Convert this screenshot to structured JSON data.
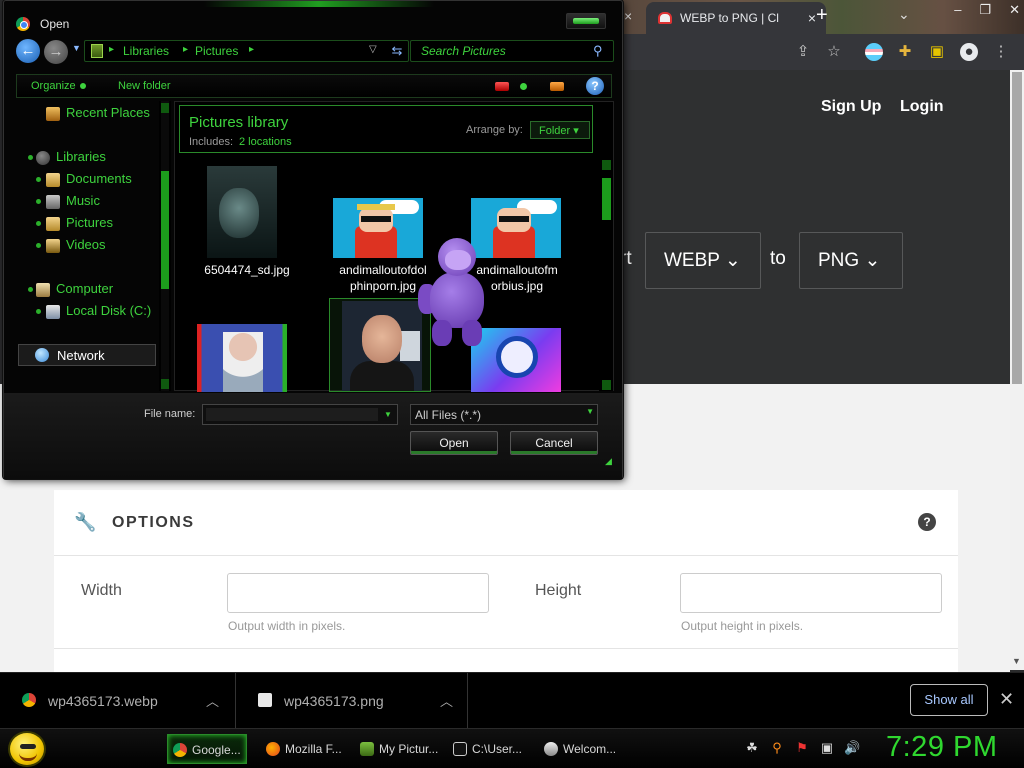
{
  "browser": {
    "tab_title": "WEBP to PNG | Cl",
    "new_tab": "+",
    "tab_close": "×",
    "tab_x_left": "×",
    "tab_menu": "⌄"
  },
  "site": {
    "signup": "Sign Up",
    "login": "Login",
    "convert_partial": "rt",
    "from_format": "WEBP",
    "to_word": "to",
    "to_format": "PNG",
    "options_title": "OPTIONS",
    "help_glyph": "?",
    "width_label": "Width",
    "width_hint": "Output width in pixels.",
    "height_label": "Height",
    "height_hint": "Output height in pixels."
  },
  "downloads": {
    "items": [
      {
        "name": "wp4365173.webp"
      },
      {
        "name": "wp4365173.png"
      }
    ],
    "show_all": "Show all",
    "close": "✕"
  },
  "taskbar": {
    "buttons": [
      {
        "label": "Google...",
        "active": true
      },
      {
        "label": "Mozilla F...",
        "active": false
      },
      {
        "label": "My Pictur...",
        "active": false
      },
      {
        "label": "C:\\User...",
        "active": false
      },
      {
        "label": "Welcom...",
        "active": false
      }
    ],
    "clock": "7:29 PM"
  },
  "dialog": {
    "title": "Open",
    "breadcrumbs": [
      "Libraries",
      "Pictures"
    ],
    "search_placeholder": "Search Pictures",
    "organize": "Organize",
    "new_folder": "New folder",
    "help": "?",
    "nav": {
      "recent_places": "Recent Places",
      "libraries": "Libraries",
      "documents": "Documents",
      "music": "Music",
      "pictures": "Pictures",
      "videos": "Videos",
      "computer": "Computer",
      "local_disk": "Local Disk (C:)",
      "network": "Network"
    },
    "library": {
      "title": "Pictures library",
      "includes_label": "Includes:",
      "locations": "2 locations",
      "arrange_label": "Arrange by:",
      "arrange_value": "Folder"
    },
    "files": [
      {
        "name": "6504474_sd.jpg"
      },
      {
        "name": "andimalloutofdol phinporn.jpg"
      },
      {
        "name": "andimalloutofm orbius.jpg"
      },
      {
        "name": ""
      },
      {
        "name": ""
      },
      {
        "name": ""
      }
    ],
    "file_name_label": "File name:",
    "file_name_value": "",
    "filter": "All Files (*.*)",
    "open_button": "Open",
    "cancel_button": "Cancel"
  },
  "colors": {
    "accent_green": "#3ed33e",
    "clock_green": "#2fd82f",
    "show_all_blue": "#a8c8ff"
  }
}
